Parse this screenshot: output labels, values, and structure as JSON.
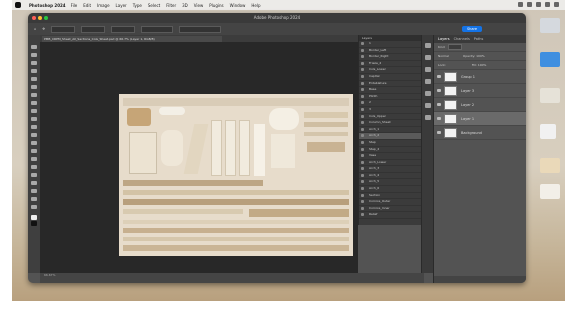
{
  "menubar": {
    "app": "Photoshop 2024",
    "items": [
      "File",
      "Edit",
      "Image",
      "Layer",
      "Type",
      "Select",
      "Filter",
      "3D",
      "View",
      "Plugins",
      "Window",
      "Help"
    ]
  },
  "window": {
    "title": "Adobe Photoshop 2024",
    "share_label": "Share",
    "document_tab": "PMB_CRPM_Sheet_All_Sections_Cols_Sheet.psd @ 66.7% (Layer 1, RGB/8)",
    "status": "66.67%"
  },
  "layers_list": {
    "header": "Layers",
    "rows": [
      "1",
      "Border_Left",
      "Border_Right",
      "Frieze_2",
      "Cols_Lower",
      "Capital",
      "Entablature",
      "Base",
      "Plinth",
      "2",
      "3",
      "Cols_Upper",
      "Column_Sheet",
      "Arch_1",
      "Arch_2",
      "Step",
      "Step_2",
      "Vase",
      "Arch_Lower",
      "Arch_3",
      "Arch_4",
      "Arch_5",
      "Arch_6",
      "Section",
      "Cornice_Outer",
      "Cornice_Inner",
      "Relief"
    ],
    "selected_index": 14
  },
  "right_panel": {
    "tabs": [
      "Layers",
      "Channels",
      "Paths"
    ],
    "kind_label": "Kind",
    "mode_label": "Normal",
    "opacity_label": "Opacity: 100%",
    "lock_label": "Lock:",
    "fill_label": "Fill: 100%",
    "layers": [
      "Group 1",
      "Layer 3",
      "Layer 2",
      "Layer 1",
      "Background"
    ],
    "selected": 3
  },
  "colors": {
    "accent": "#1473e6",
    "canvas_bg": "#282828",
    "panel_bg": "#535353",
    "doc_bg": "#e7dccb"
  }
}
